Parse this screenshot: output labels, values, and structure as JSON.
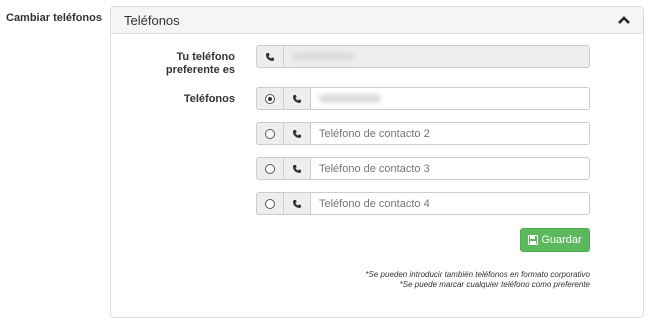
{
  "section_label": "Cambiar teléfonos",
  "panel": {
    "title": "Teléfonos",
    "collapse_icon": "chevron-up-icon"
  },
  "preferred": {
    "label": "Tu teléfono preferente es",
    "icon": "phone-icon",
    "value_obscured": true
  },
  "phones": {
    "label": "Teléfonos",
    "items": [
      {
        "selected": true,
        "value": "",
        "placeholder": "",
        "value_obscured": true
      },
      {
        "selected": false,
        "value": "",
        "placeholder": "Teléfono de contacto 2"
      },
      {
        "selected": false,
        "value": "",
        "placeholder": "Teléfono de contacto 3"
      },
      {
        "selected": false,
        "value": "",
        "placeholder": "Teléfono de contacto 4"
      }
    ]
  },
  "save_button": {
    "label": "Guardar",
    "icon": "save-icon",
    "color": "#5cb85c"
  },
  "notes": [
    "*Se pueden introducir también teléfonos en formato corporativo",
    "*Se puede marcar cualquier teléfono como preferente"
  ]
}
